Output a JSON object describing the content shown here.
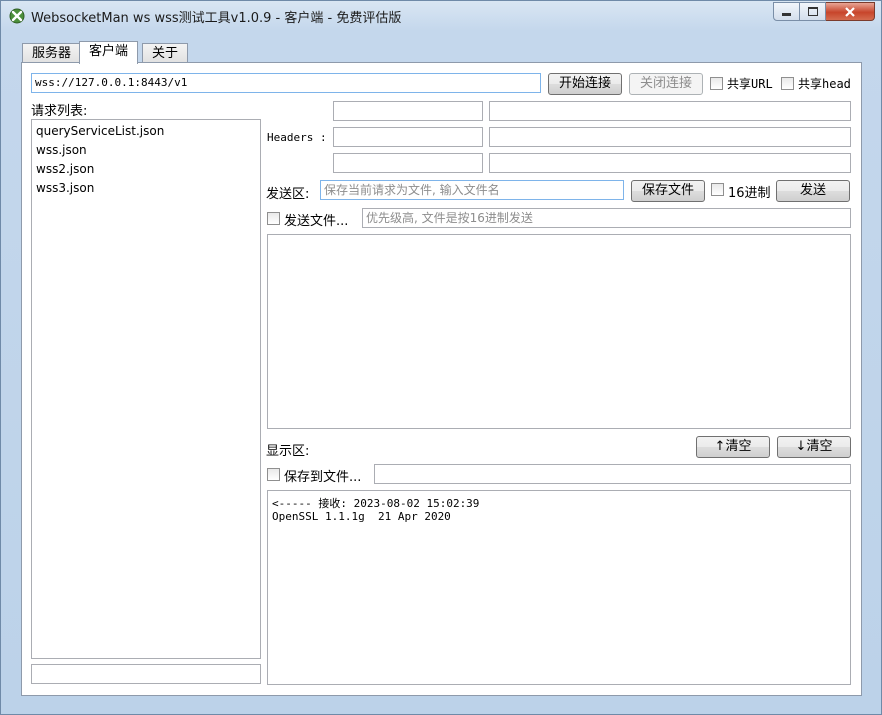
{
  "window": {
    "title": "WebsocketMan ws wss测试工具v1.0.9  - 客户端 - 免费评估版",
    "icon": "app-cross-icon"
  },
  "tabs": [
    {
      "label": "服务器"
    },
    {
      "label": "客户端"
    },
    {
      "label": "关于"
    }
  ],
  "connection": {
    "url": "wss://127.0.0.1:8443/v1",
    "connect_label": "开始连接",
    "disconnect_label": "关闭连接",
    "share_url_label": "共享URL",
    "share_head_label": "共享head"
  },
  "request_list": {
    "title": "请求列表:",
    "items": [
      "queryServiceList.json",
      "wss.json",
      "wss2.json",
      "wss3.json"
    ]
  },
  "headers_label": "Headers :",
  "send": {
    "label": "发送区:",
    "filename_placeholder": "保存当前请求为文件, 输入文件名",
    "save_file_label": "保存文件",
    "hex_label": "16进制",
    "send_label": "发送",
    "send_file_label": "发送文件...",
    "send_file_placeholder": "优先级高, 文件是按16进制发送"
  },
  "display": {
    "label": "显示区:",
    "clear_up_label": "↑清空",
    "clear_down_label": "↓清空",
    "save_to_file_label": "保存到文件...",
    "log_lines": [
      "<----- 接收: 2023-08-02 15:02:39",
      "OpenSSL 1.1.1g  21 Apr 2020"
    ]
  },
  "colors": {
    "accent_border": "#7eb4ea",
    "close_button": "#c7452b"
  }
}
